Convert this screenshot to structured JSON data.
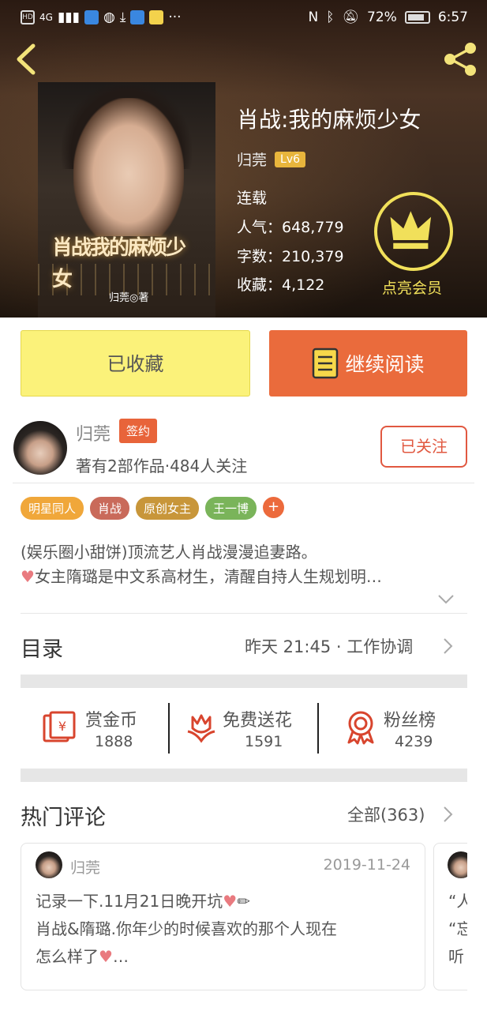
{
  "statusbar": {
    "battery": "72%",
    "time": "6:57",
    "network": "4G"
  },
  "book": {
    "title": "肖战:我的麻烦少女",
    "cover_title": "肖战我的麻烦少女",
    "cover_author": "归莞◎著",
    "author": "归莞",
    "level": "Lv6",
    "status": "连载",
    "popularity": "人气：648,779",
    "words": "字数：210,379",
    "favorites": "收藏：4,122",
    "vip_label": "点亮会员"
  },
  "actions": {
    "collected_label": "已收藏",
    "read_label": "继续阅读"
  },
  "author_info": {
    "name": "归莞",
    "badge": "签约",
    "works": "著有2部作品·484人关注",
    "follow_label": "已关注"
  },
  "tags": [
    {
      "label": "明星同人",
      "color": "#f0a73a"
    },
    {
      "label": "肖战",
      "color": "#c96a5a"
    },
    {
      "label": "原创女主",
      "color": "#c8963a"
    },
    {
      "label": "王一博",
      "color": "#7ab45a"
    }
  ],
  "tag_more": "+",
  "description": {
    "line1": "(娱乐圈小甜饼)顶流艺人肖战漫漫追妻路。",
    "line2": "女主隋璐是中文系高材生，清醒自持人生规划明…"
  },
  "catalog": {
    "title": "目录",
    "latest": "昨天 21:45 · 工作协调"
  },
  "rewards": [
    {
      "label": "赏金币",
      "value": "1888",
      "icon": "money-icon"
    },
    {
      "label": "免费送花",
      "value": "1591",
      "icon": "flower-icon"
    },
    {
      "label": "粉丝榜",
      "value": "4239",
      "icon": "medal-icon"
    }
  ],
  "comments": {
    "title": "热门评论",
    "all_label": "全部(363)",
    "items": [
      {
        "name": "归莞",
        "date": "2019-11-24",
        "line1": "记录一下.11月21日晚开坑",
        "line2": "肖战&隋璐.你年少的时候喜欢的那个人现在",
        "line3": "怎么样了"
      },
      {
        "line1": "“人",
        "line2": "“忘",
        "line3": "听"
      }
    ]
  },
  "colors": {
    "accent_orange": "#ea6b3c",
    "collected_yellow": "#fbf27a",
    "vip_gold": "#f1e05a"
  }
}
